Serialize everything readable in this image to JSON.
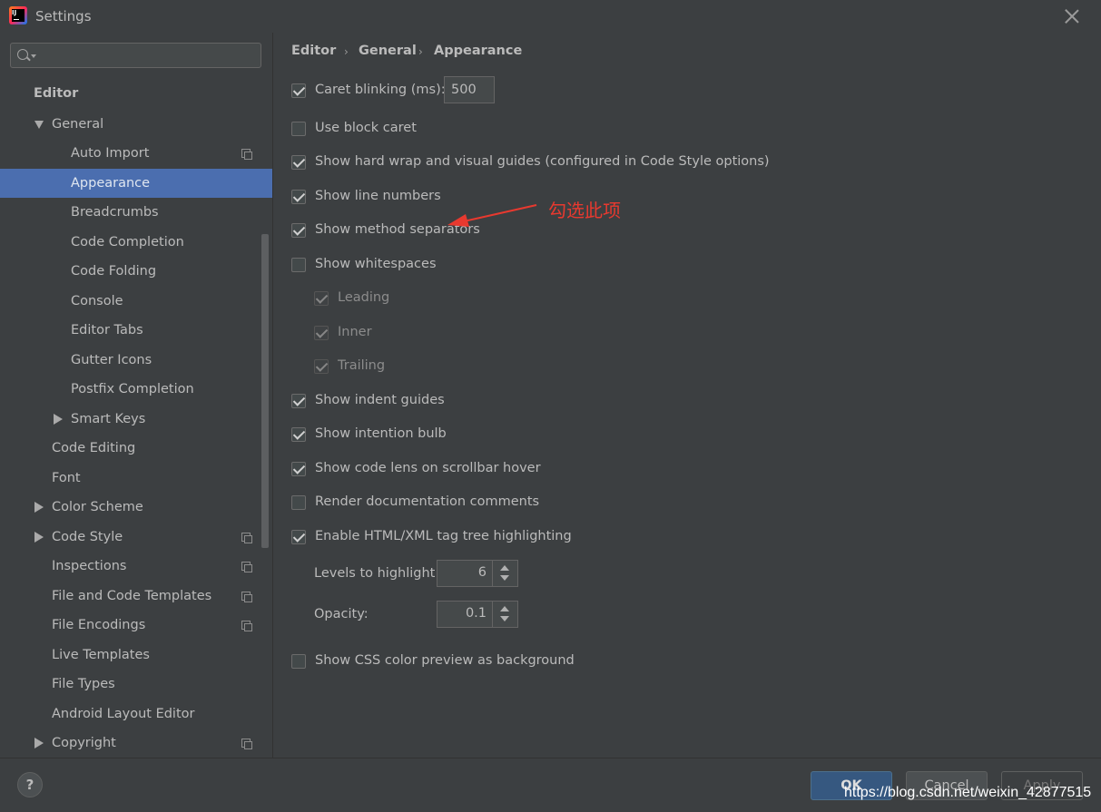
{
  "window": {
    "title": "Settings",
    "app_icon_text": "IJ"
  },
  "search": {
    "placeholder": "",
    "value": ""
  },
  "sidebar": {
    "items": [
      {
        "label": "Editor"
      },
      {
        "label": "General"
      },
      {
        "label": "Auto Import"
      },
      {
        "label": "Appearance"
      },
      {
        "label": "Breadcrumbs"
      },
      {
        "label": "Code Completion"
      },
      {
        "label": "Code Folding"
      },
      {
        "label": "Console"
      },
      {
        "label": "Editor Tabs"
      },
      {
        "label": "Gutter Icons"
      },
      {
        "label": "Postfix Completion"
      },
      {
        "label": "Smart Keys"
      },
      {
        "label": "Code Editing"
      },
      {
        "label": "Font"
      },
      {
        "label": "Color Scheme"
      },
      {
        "label": "Code Style"
      },
      {
        "label": "Inspections"
      },
      {
        "label": "File and Code Templates"
      },
      {
        "label": "File Encodings"
      },
      {
        "label": "Live Templates"
      },
      {
        "label": "File Types"
      },
      {
        "label": "Android Layout Editor"
      },
      {
        "label": "Copyright"
      }
    ]
  },
  "breadcrumb": {
    "items": [
      "Editor",
      "General",
      "Appearance"
    ],
    "separator": "›"
  },
  "options": {
    "caret_blinking": {
      "label": "Caret blinking (ms):",
      "value": "500",
      "checked": true
    },
    "use_block_caret": {
      "label": "Use block caret",
      "checked": false
    },
    "hard_wrap": {
      "label": "Show hard wrap and visual guides (configured in Code Style options)",
      "checked": true
    },
    "line_numbers": {
      "label": "Show line numbers",
      "checked": true
    },
    "method_separators": {
      "label": "Show method separators",
      "checked": true
    },
    "whitespaces": {
      "label": "Show whitespaces",
      "checked": false
    },
    "leading": {
      "label": "Leading",
      "checked": true,
      "disabled": true
    },
    "inner": {
      "label": "Inner",
      "checked": true,
      "disabled": true
    },
    "trailing": {
      "label": "Trailing",
      "checked": true,
      "disabled": true
    },
    "indent_guides": {
      "label": "Show indent guides",
      "checked": true
    },
    "intention_bulb": {
      "label": "Show intention bulb",
      "checked": true
    },
    "code_lens": {
      "label": "Show code lens on scrollbar hover",
      "checked": true
    },
    "render_docs": {
      "label": "Render documentation comments",
      "checked": false
    },
    "tag_tree": {
      "label": "Enable HTML/XML tag tree highlighting",
      "checked": true
    },
    "levels": {
      "label": "Levels to highlight:",
      "value": "6"
    },
    "opacity": {
      "label": "Opacity:",
      "value": "0.1"
    },
    "css_preview": {
      "label": "Show CSS color preview as background",
      "checked": false
    }
  },
  "annotation": {
    "text": "勾选此项",
    "color": "#e8392f"
  },
  "footer": {
    "help_label": "?",
    "ok_label": "OK",
    "cancel_label": "Cancel",
    "apply_label": "Apply",
    "watermark": "https://blog.csdn.net/weixin_42877515"
  },
  "colors": {
    "background": "#3c3f41",
    "selection": "#4b6eaf",
    "ok_button": "#365880",
    "text": "#bbbbbb"
  }
}
